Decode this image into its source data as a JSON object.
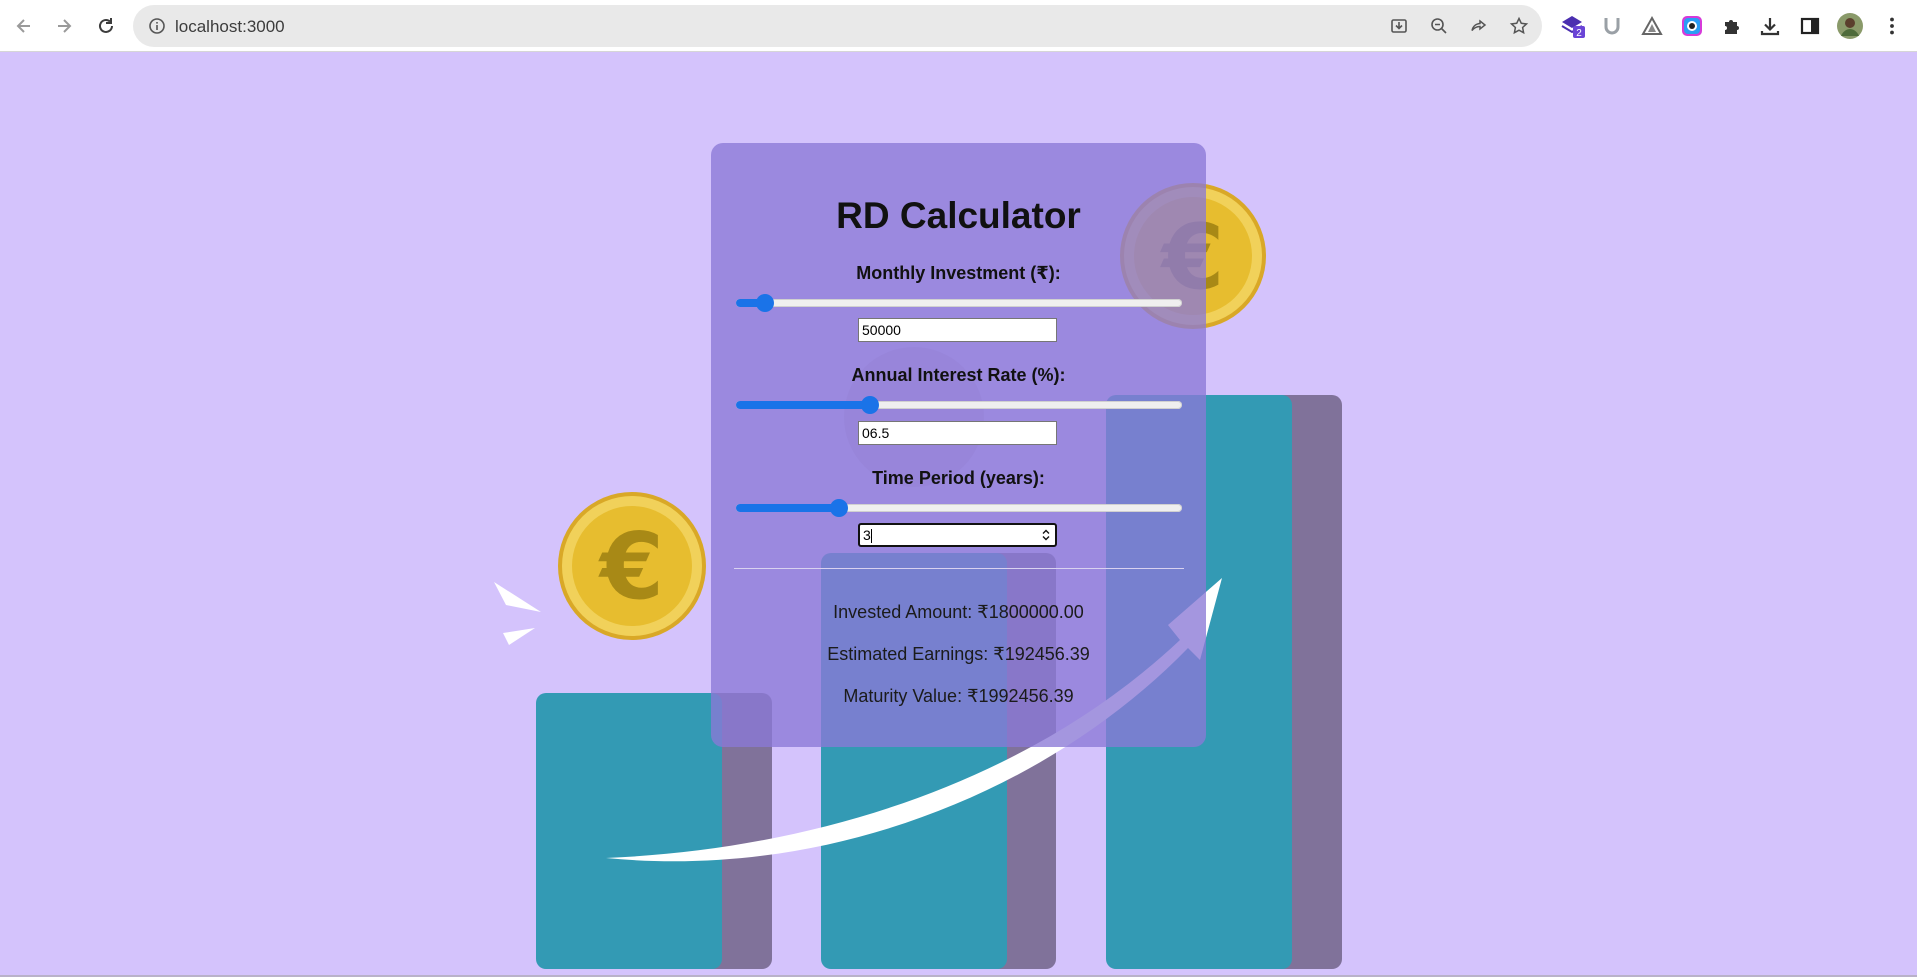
{
  "browser": {
    "url": "localhost:3000",
    "extension_badge": "2",
    "icons": [
      "back-arrow-icon",
      "forward-arrow-icon",
      "reload-icon",
      "site-info-icon",
      "install-app-icon",
      "zoom-icon",
      "share-icon",
      "bookmark-star-icon",
      "extension-icon",
      "extensions-puzzle-icon",
      "downloads-icon",
      "side-panel-icon",
      "profile-avatar-icon",
      "menu-dots-icon"
    ]
  },
  "calculator": {
    "title": "RD Calculator",
    "monthly_investment": {
      "label": "Monthly Investment (₹):",
      "value": "50000",
      "slider_fraction": 0.065
    },
    "interest_rate": {
      "label": "Annual Interest Rate (%):",
      "value": "06.5",
      "slider_fraction": 0.3
    },
    "time_period": {
      "label": "Time Period (years):",
      "value": "3",
      "slider_fraction": 0.23
    },
    "results": {
      "invested": "Invested Amount: ₹1800000.00",
      "earnings": "Estimated Earnings: ₹192456.39",
      "maturity": "Maturity Value: ₹1992456.39"
    }
  },
  "colors": {
    "background": "#d4c3fc",
    "card": "#8b79d6",
    "slider_accent": "#1a73e8",
    "bar_teal": "#339ab4",
    "bar_shadow": "#80729a",
    "coin_gold": "#e9bf2e"
  }
}
